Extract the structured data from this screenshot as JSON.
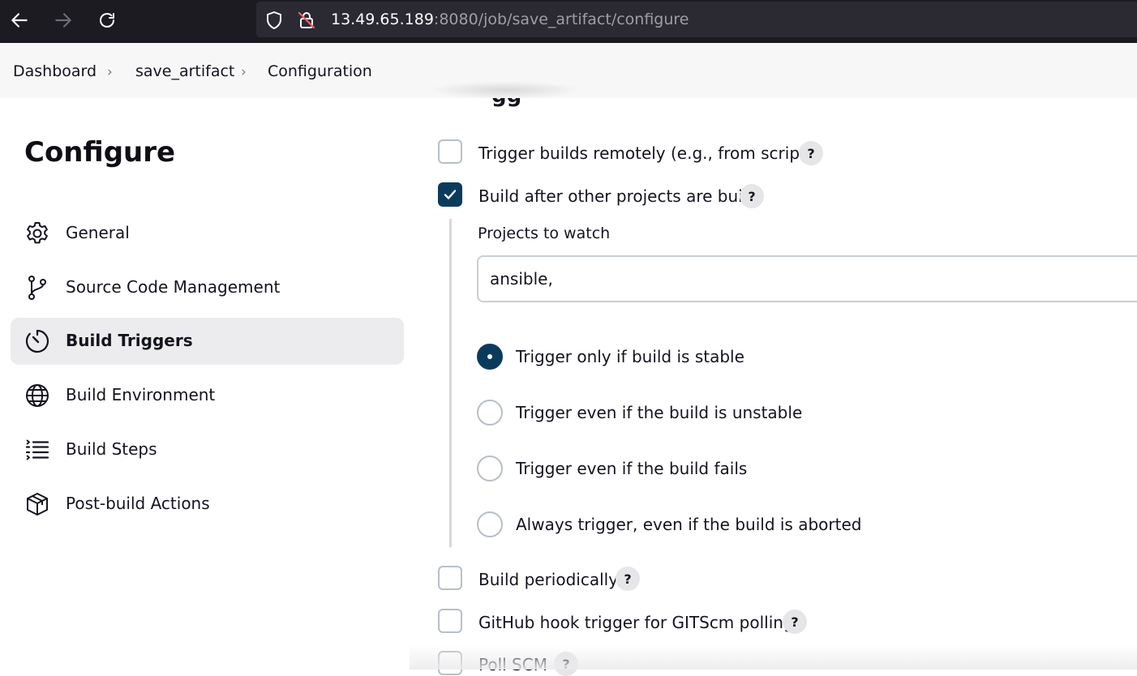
{
  "browser": {
    "url_host": "13.49.65.189",
    "url_rest": ":8080/job/save_artifact/configure"
  },
  "breadcrumb": [
    "Dashboard",
    "save_artifact",
    "Configuration"
  ],
  "section_header_partial": "gg",
  "sidebar": {
    "title": "Configure",
    "items": [
      {
        "label": "General",
        "icon": "gear-icon"
      },
      {
        "label": "Source Code Management",
        "icon": "branch-icon"
      },
      {
        "label": "Build Triggers",
        "icon": "timer-icon",
        "active": true
      },
      {
        "label": "Build Environment",
        "icon": "globe-icon"
      },
      {
        "label": "Build Steps",
        "icon": "list-icon"
      },
      {
        "label": "Post-build Actions",
        "icon": "package-icon"
      }
    ]
  },
  "triggers": {
    "remote": {
      "label": "Trigger builds remotely (e.g., from scripts)",
      "checked": false
    },
    "after_other": {
      "label": "Build after other projects are built",
      "checked": true
    },
    "projects_label": "Projects to watch",
    "projects_value": "ansible,",
    "radios": [
      {
        "label": "Trigger only if build is stable",
        "checked": true
      },
      {
        "label": "Trigger even if the build is unstable",
        "checked": false
      },
      {
        "label": "Trigger even if the build fails",
        "checked": false
      },
      {
        "label": "Always trigger, even if the build is aborted",
        "checked": false
      }
    ],
    "periodically": {
      "label": "Build periodically",
      "checked": false
    },
    "github_hook": {
      "label": "GitHub hook trigger for GITScm polling",
      "checked": false
    },
    "poll_scm": {
      "label": "Poll SCM",
      "checked": false
    },
    "help_label": "?"
  },
  "colors": {
    "accent": "#0b3b5c",
    "browser_bg": "#1c1b22"
  }
}
